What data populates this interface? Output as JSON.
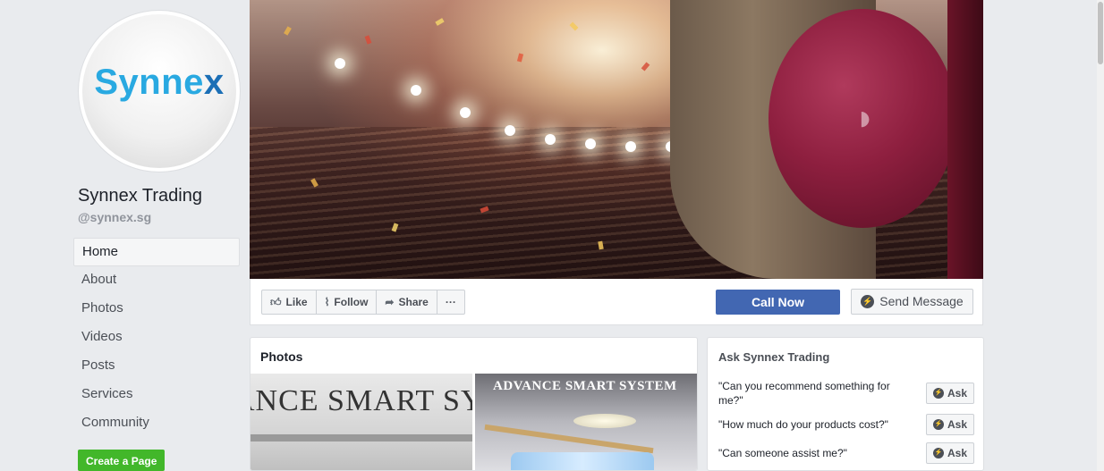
{
  "page": {
    "logo_text": "Synne",
    "logo_x": "x",
    "name": "Synnex Trading",
    "handle": "@synnex.sg"
  },
  "nav": {
    "items": [
      "Home",
      "About",
      "Photos",
      "Videos",
      "Posts",
      "Services",
      "Community"
    ],
    "active": "Home"
  },
  "create_page": "Create a Page",
  "actions": {
    "like": "Like",
    "follow": "Follow",
    "share": "Share",
    "more": "···",
    "call_now": "Call Now",
    "send_message": "Send Message"
  },
  "photos": {
    "title": "Photos",
    "photo1_text": "ANCE SMART SY",
    "photo2_text": "ADVANCE SMART SYSTEM"
  },
  "ask": {
    "title": "Ask Synnex Trading",
    "button_label": "Ask",
    "questions": [
      "\"Can you recommend something for me?\"",
      "\"How much do your products cost?\"",
      "\"Can someone assist me?\""
    ]
  },
  "colors": {
    "accent_blue": "#4267b2",
    "green": "#42b72a",
    "background": "#e9ebee"
  }
}
